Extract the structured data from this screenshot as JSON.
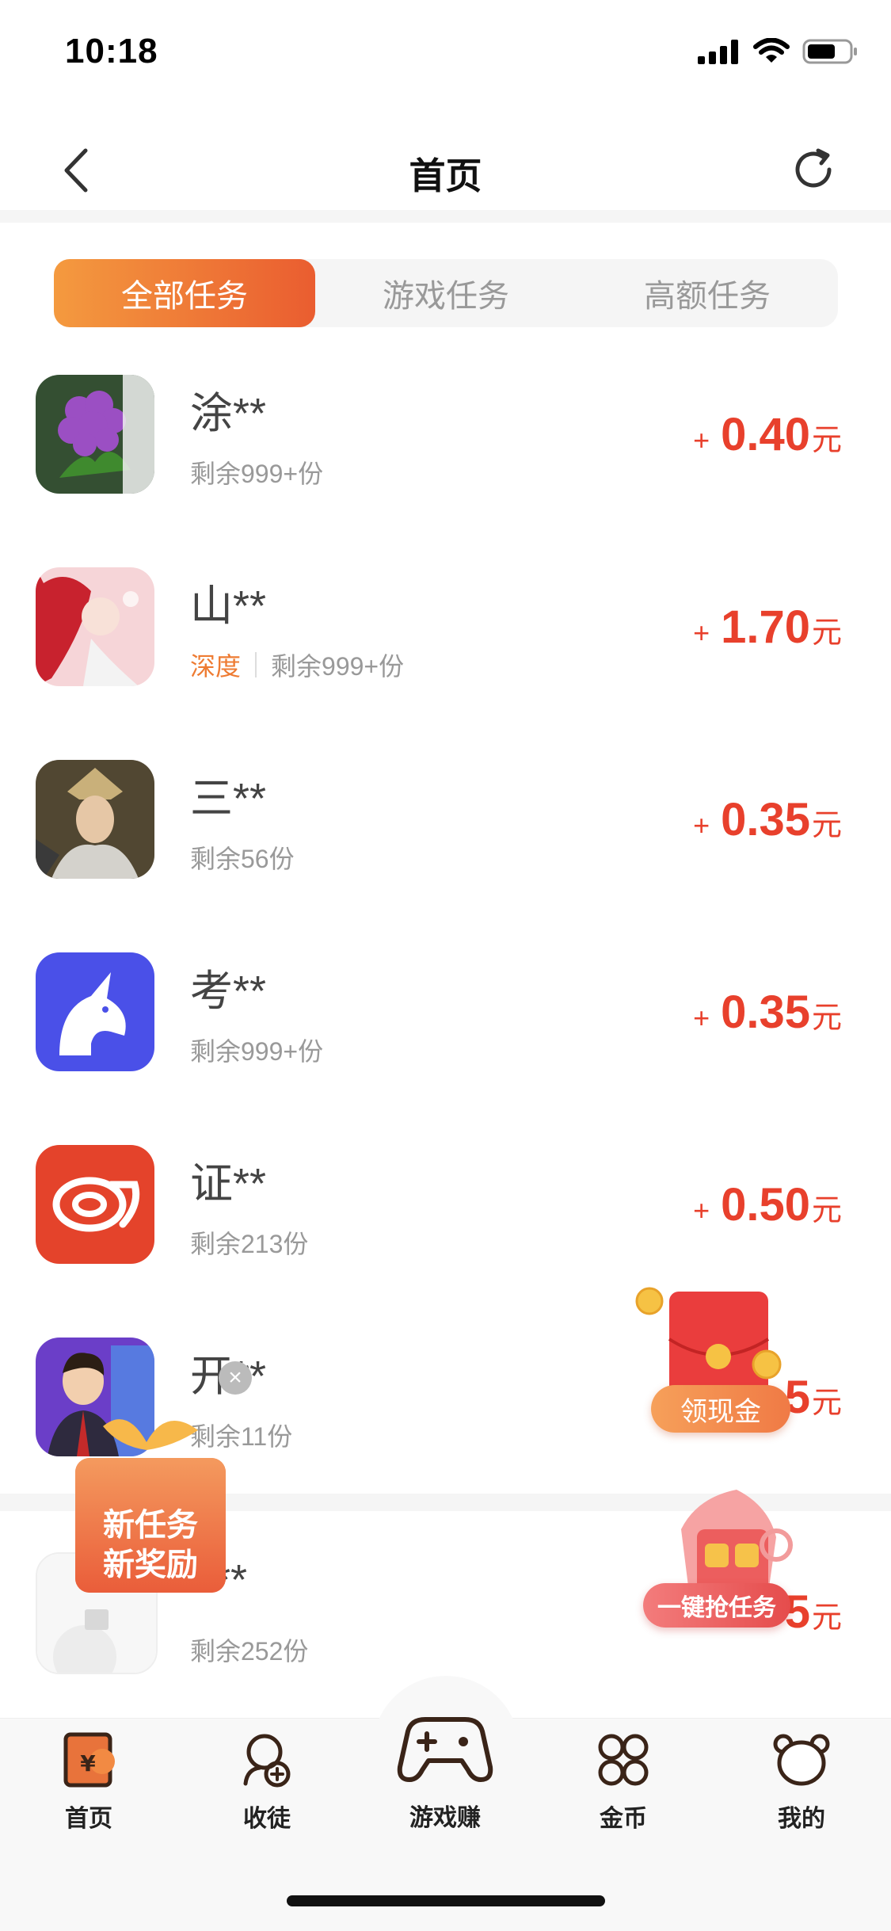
{
  "status": {
    "time": "10:18"
  },
  "nav": {
    "title": "首页"
  },
  "tabs": [
    {
      "label": "全部任务",
      "active": true
    },
    {
      "label": "游戏任务",
      "active": false
    },
    {
      "label": "高额任务",
      "active": false
    }
  ],
  "tasks": [
    {
      "name": "涂**",
      "tag": "",
      "remaining": "剩余999+份",
      "plus": "+",
      "amount": "0.40",
      "unit": "元",
      "icon": "flower-icon"
    },
    {
      "name": "山**",
      "tag": "深度",
      "remaining": "剩余999+份",
      "plus": "+",
      "amount": "1.70",
      "unit": "元",
      "icon": "red-hair-woman-icon"
    },
    {
      "name": "三**",
      "tag": "",
      "remaining": "剩余56份",
      "plus": "+",
      "amount": "0.35",
      "unit": "元",
      "icon": "warrior-icon"
    },
    {
      "name": "考**",
      "tag": "",
      "remaining": "剩余999+份",
      "plus": "+",
      "amount": "0.35",
      "unit": "元",
      "icon": "unicorn-icon"
    },
    {
      "name": "证**",
      "tag": "",
      "remaining": "剩余213份",
      "plus": "+",
      "amount": "0.50",
      "unit": "元",
      "icon": "securities-logo-icon"
    },
    {
      "name": "开**",
      "tag": "",
      "remaining": "剩余11份",
      "plus": "+",
      "amount": "5",
      "unit": "元",
      "icon": "cartoon-man-icon"
    },
    {
      "name": "**",
      "tag": "",
      "remaining": "剩余252份",
      "plus": "+",
      "amount": "5",
      "unit": "元",
      "icon": "placeholder-app-icon"
    }
  ],
  "floats": {
    "redpacket_label": "领现金",
    "grab_label": "一键抢任务",
    "newtask_line1": "新任务",
    "newtask_line2": "新奖励",
    "close": "×"
  },
  "tabbar": [
    {
      "label": "首页",
      "icon": "home-icon"
    },
    {
      "label": "收徒",
      "icon": "add-friend-icon"
    },
    {
      "label": "游戏赚",
      "icon": "gamepad-icon"
    },
    {
      "label": "金币",
      "icon": "coins-icon"
    },
    {
      "label": "我的",
      "icon": "bear-icon"
    }
  ],
  "colors": {
    "accent_start": "#f49a3f",
    "accent_end": "#ea5d30",
    "reward": "#e8402c",
    "tag": "#ee7b32"
  }
}
